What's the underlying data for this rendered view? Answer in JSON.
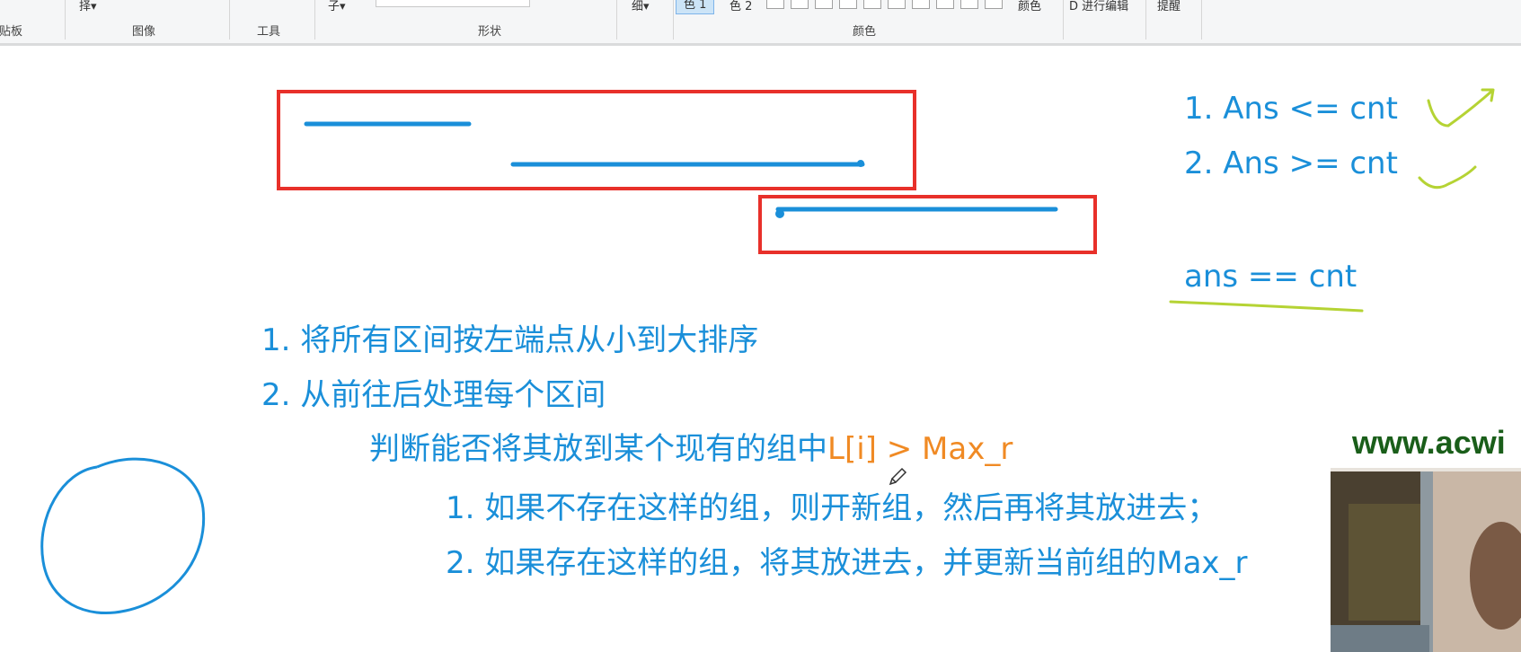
{
  "ribbon": {
    "groups": {
      "clipboard": "剪贴板",
      "image": "图像",
      "tools": "工具",
      "shapes": "形状",
      "colors": "颜色"
    },
    "controls": {
      "select_partial": "择▾",
      "outline_partial": "子▾",
      "size": "细▾",
      "color1": "色 1",
      "color2": "色 2",
      "edit_colors": "颜色",
      "paint3d": "D 进行编辑",
      "alert": "提醒"
    }
  },
  "notes": {
    "conditions": {
      "line1": "1. Ans <= cnt",
      "line2": "2. Ans >= cnt",
      "result": "ans == cnt"
    },
    "algorithm": {
      "step1": "1. 将所有区间按左端点从小到大排序",
      "step2": "2. 从前往后处理每个区间",
      "judge": "判断能否将其放到某个现有的组中",
      "condition": "L[i] > Max_r",
      "case1": "1. 如果不存在这样的组，则开新组，然后再将其放进去；",
      "case2": "2. 如果存在这样的组，将其放进去，并更新当前组的Max_r"
    }
  },
  "watermark": {
    "url": "www.acwi"
  },
  "colors": {
    "ink_blue": "#1a8fd9",
    "ink_red": "#e8302a",
    "ink_green": "#b5d334",
    "ink_orange": "#f08a24"
  }
}
